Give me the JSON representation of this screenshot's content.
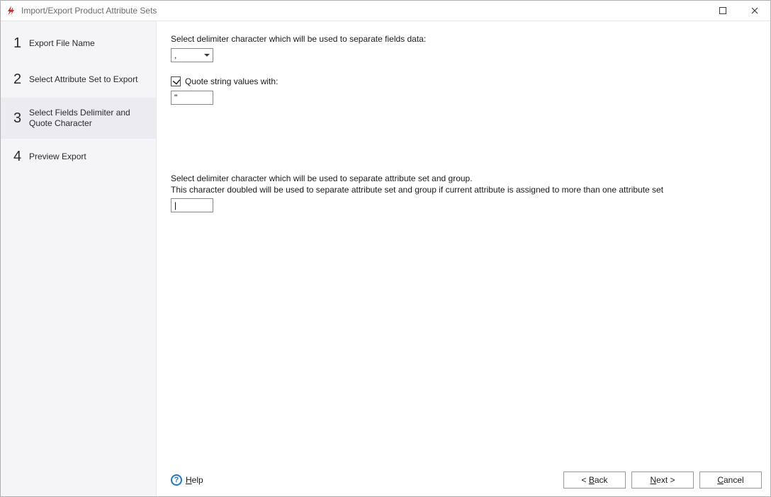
{
  "window": {
    "title": "Import/Export Product Attribute Sets"
  },
  "sidebar": {
    "steps": [
      {
        "num": "1",
        "label": "Export File Name"
      },
      {
        "num": "2",
        "label": "Select Attribute Set to Export"
      },
      {
        "num": "3",
        "label": "Select Fields Delimiter and Quote Character"
      },
      {
        "num": "4",
        "label": "Preview Export"
      }
    ],
    "active_index": 2
  },
  "form": {
    "delimiter_label": "Select delimiter character which will be used to separate fields data:",
    "delimiter_value": ",",
    "quote_checkbox_label": "Quote string values with:",
    "quote_checked": true,
    "quote_value": "\"",
    "group_delim_line1": "Select delimiter character which will be used to separate attribute set and group.",
    "group_delim_line2": "This character doubled will be used to separate attribute set and group if current attribute is assigned to more than one attribute set",
    "group_delim_value": "|"
  },
  "footer": {
    "help": "Help",
    "back_full": "< Back",
    "next_full": "Next >",
    "cancel": "Cancel"
  }
}
